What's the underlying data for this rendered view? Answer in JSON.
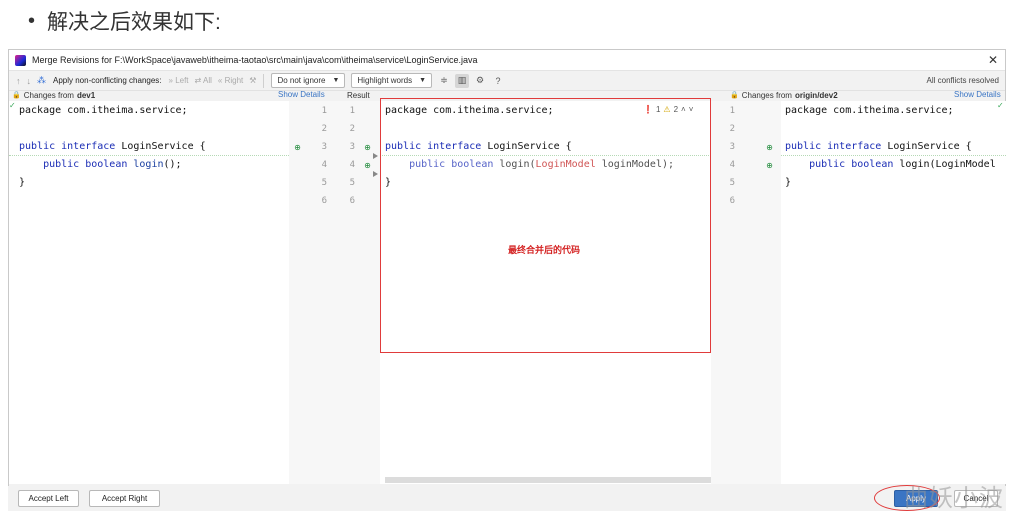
{
  "heading": {
    "bullet": "•",
    "text": "解决之后效果如下:"
  },
  "window": {
    "title": "Merge Revisions for F:\\WorkSpace\\javaweb\\itheima-taotao\\src\\main\\java\\com\\itheima\\service\\LoginService.java",
    "close_icon": "✕"
  },
  "toolbar": {
    "apply_label": "Apply non-conflicting changes:",
    "left": "Left",
    "all": "All",
    "right": "Right",
    "ignore_select": "Do not ignore",
    "highlight_select": "Highlight words",
    "help": "?",
    "status": "All conflicts resolved"
  },
  "left_pane": {
    "header_prefix": "Changes from",
    "branch": "dev1",
    "show_details": "Show Details"
  },
  "center_pane": {
    "header": "Result"
  },
  "right_pane": {
    "header_prefix": "Changes from",
    "branch": "origin/dev2",
    "show_details": "Show Details"
  },
  "left_code": {
    "l1": "package com.itheima.service;",
    "l3a": "public interface",
    "l3b": " LoginService {",
    "l4a": "    public boolean",
    "l4b": " login",
    "l4c": "();",
    "l5": "}"
  },
  "result_code": {
    "l1": "package com.itheima.service;",
    "l3a": "public interface",
    "l3b": " LoginService {",
    "l4a": "    public boolean",
    "l4b": " login(",
    "l4c": "LoginModel",
    "l4d": " loginModel);",
    "l5": "}"
  },
  "right_code": {
    "l1": "package com.itheima.service;",
    "l3a": "public interface",
    "l3b": " LoginService {",
    "l4a": "    public boolean",
    "l4b": " login(LoginModel",
    "l5": "}"
  },
  "line_numbers": [
    "1",
    "2",
    "3",
    "4",
    "5",
    "6"
  ],
  "problems": {
    "errors": "1",
    "warnings": "2"
  },
  "annotation": "最终合并后的代码",
  "buttons": {
    "accept_left": "Accept Left",
    "accept_right": "Accept Right",
    "apply": "Apply",
    "cancel": "Cancel"
  },
  "watermark": "曲妖小波"
}
